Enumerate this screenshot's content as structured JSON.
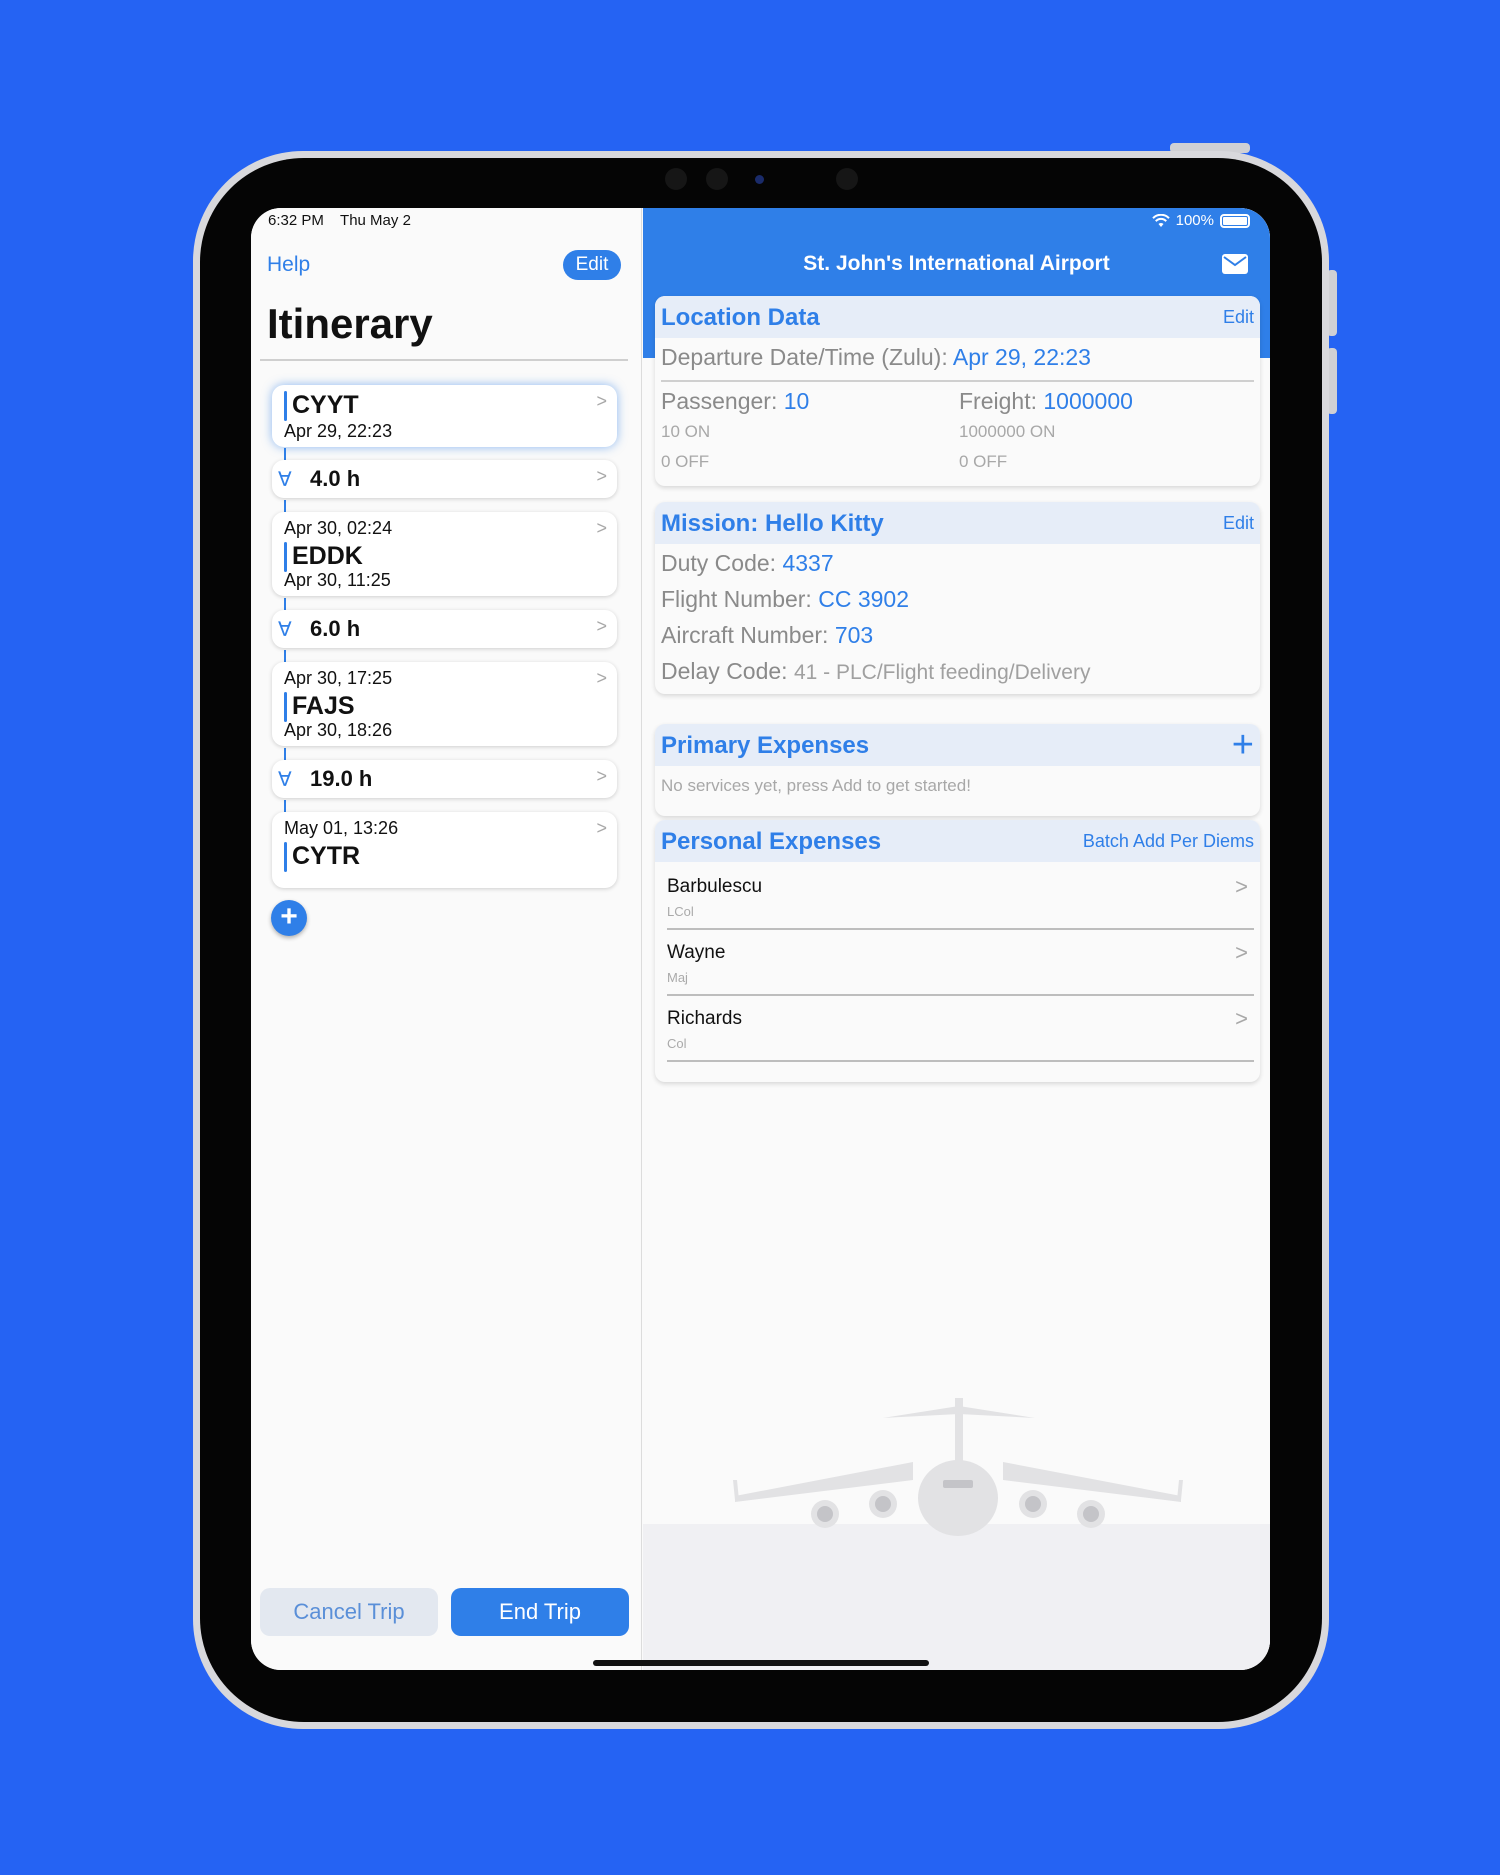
{
  "status": {
    "time": "6:32 PM",
    "date": "Thu May 2",
    "battery": "100%"
  },
  "left": {
    "help": "Help",
    "edit": "Edit",
    "title": "Itinerary",
    "stops": [
      {
        "code": "CYYT",
        "depart": "Apr 29, 22:23"
      },
      {
        "code": "EDDK",
        "arrive": "Apr 30, 02:24",
        "depart": "Apr 30, 11:25"
      },
      {
        "code": "FAJS",
        "arrive": "Apr 30, 17:25",
        "depart": "Apr 30, 18:26"
      },
      {
        "code": "CYTR",
        "arrive": "May 01, 13:26"
      }
    ],
    "durations": [
      "4.0 h",
      "6.0 h",
      "19.0 h"
    ],
    "cancel": "Cancel Trip",
    "end": "End Trip"
  },
  "right": {
    "title": "St. John's International Airport",
    "location": {
      "title": "Location Data",
      "edit": "Edit",
      "departure_label": "Departure Date/Time (Zulu):",
      "departure_value": "Apr 29, 22:23",
      "passenger_label": "Passenger:",
      "passenger_value": "10",
      "passenger_on": "10 ON",
      "passenger_off": "0 OFF",
      "freight_label": "Freight:",
      "freight_value": "1000000",
      "freight_on": "1000000 ON",
      "freight_off": "0 OFF"
    },
    "mission": {
      "title": "Mission: Hello Kitty",
      "edit": "Edit",
      "duty_label": "Duty Code:",
      "duty_value": "4337",
      "flight_label": "Flight Number:",
      "flight_value": "CC 3902",
      "aircraft_label": "Aircraft Number:",
      "aircraft_value": "703",
      "delay_label": "Delay Code:",
      "delay_value": "41 - PLC/Flight feeding/Delivery"
    },
    "primary": {
      "title": "Primary Expenses",
      "empty": "No services yet, press Add to get started!"
    },
    "personal": {
      "title": "Personal Expenses",
      "batch": "Batch Add Per Diems",
      "people": [
        {
          "name": "Barbulescu",
          "rank": "LCol"
        },
        {
          "name": "Wayne",
          "rank": "Maj"
        },
        {
          "name": "Richards",
          "rank": "Col"
        }
      ]
    }
  },
  "colors": {
    "accent": "#2f7fe8",
    "background": "#2563f3"
  },
  "icons": [
    "wifi-icon",
    "battery-icon",
    "mail-icon",
    "chevron-right-icon",
    "plus-icon",
    "flight-leg-icon",
    "cargo-plane-illustration"
  ]
}
